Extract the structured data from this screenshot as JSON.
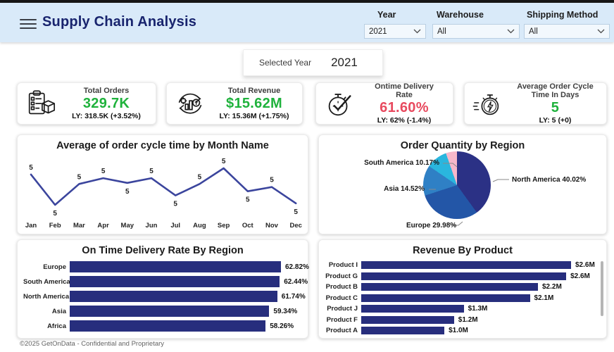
{
  "header": {
    "title": "Supply Chain Analysis",
    "filters": [
      {
        "label": "Year",
        "value": "2021"
      },
      {
        "label": "Warehouse",
        "value": "All"
      },
      {
        "label": "Shipping Method",
        "value": "All"
      }
    ]
  },
  "selected_year": {
    "label": "Selected Year",
    "value": "2021"
  },
  "colors": {
    "positive": "#1fb23c",
    "negative": "#e84a5f",
    "bar_navy": "#272e7d",
    "line_navy": "#3b459d",
    "header_bg": "#d9eaf9",
    "title_navy": "#18246e"
  },
  "kpis": [
    {
      "icon": "clipboard-box-icon",
      "title": "Total Orders",
      "value": "329.7K",
      "value_color": "#1fb23c",
      "ly": "LY: 318.5K (+3.52%)"
    },
    {
      "icon": "revenue-cycle-icon",
      "title": "Total Revenue",
      "value": "$15.62M",
      "value_color": "#1fb23c",
      "ly": "LY: 15.36M (+1.75%)"
    },
    {
      "icon": "stopwatch-check-icon",
      "title": "Ontime Delivery Rate",
      "value": "61.60%",
      "value_color": "#e84a5f",
      "ly": "LY: 62% (-1.4%)"
    },
    {
      "icon": "stopwatch-fast-icon",
      "title": "Average Order Cycle Time In Days",
      "value": "5",
      "value_color": "#1fb23c",
      "ly": "LY: 5 (+0)"
    }
  ],
  "chart_data": [
    {
      "type": "line",
      "title": "Average of order cycle time by Month Name",
      "categories": [
        "Jan",
        "Feb",
        "Mar",
        "Apr",
        "May",
        "Jun",
        "Jul",
        "Aug",
        "Sep",
        "Oct",
        "Nov",
        "Dec"
      ],
      "values": [
        5.18,
        4.6,
        5.0,
        5.11,
        5.02,
        5.11,
        4.78,
        5.0,
        5.3,
        4.86,
        4.94,
        4.63
      ],
      "data_labels": [
        "5",
        "5",
        "5",
        "5",
        "5",
        "5",
        "5",
        "5",
        "5",
        "5",
        "5",
        "5"
      ],
      "label_positions": [
        "above",
        "below",
        "above",
        "above",
        "below",
        "above",
        "below",
        "above",
        "above",
        "below",
        "above",
        "below"
      ],
      "line_color": "#3b459d",
      "ylim": [
        4.5,
        5.4
      ],
      "grid": false
    },
    {
      "type": "pie",
      "title": "Order Quantity by Region",
      "slices": [
        {
          "label": "North America",
          "value": 40.02,
          "display": "North America 40.02%",
          "color": "#2b3185"
        },
        {
          "label": "Europe",
          "value": 29.98,
          "display": "Europe 29.98%",
          "color": "#2356a7"
        },
        {
          "label": "Asia",
          "value": 14.52,
          "display": "Asia 14.52%",
          "color": "#2f80c5"
        },
        {
          "label": "South America",
          "value": 10.17,
          "display": "South America 10.17%",
          "color": "#2ab6de"
        },
        {
          "label": "",
          "value": 5.31,
          "display": "",
          "color": "#f6b8ca"
        }
      ]
    },
    {
      "type": "bar",
      "title": "On Time Delivery Rate By Region",
      "categories": [
        "Europe",
        "South America",
        "North America",
        "Asia",
        "Africa"
      ],
      "values": [
        62.82,
        62.44,
        61.74,
        59.34,
        58.26
      ],
      "value_labels": [
        "62.82%",
        "62.44%",
        "61.74%",
        "59.34%",
        "58.26%"
      ],
      "orientation": "horizontal",
      "bar_color": "#272e7d"
    },
    {
      "type": "bar",
      "title": "Revenue By Product",
      "categories": [
        "Product I",
        "Product G",
        "Product B",
        "Product C",
        "Product J",
        "Product F",
        "Product A"
      ],
      "values": [
        2.6,
        2.54,
        2.19,
        2.09,
        1.27,
        1.15,
        1.03
      ],
      "value_labels": [
        "$2.6M",
        "$2.6M",
        "$2.2M",
        "$2.1M",
        "$1.3M",
        "$1.2M",
        "$1.0M"
      ],
      "orientation": "horizontal",
      "bar_color": "#272e7d"
    }
  ],
  "footer": {
    "copyright": "©2025 GetOnData - Confidential and Proprietary"
  }
}
